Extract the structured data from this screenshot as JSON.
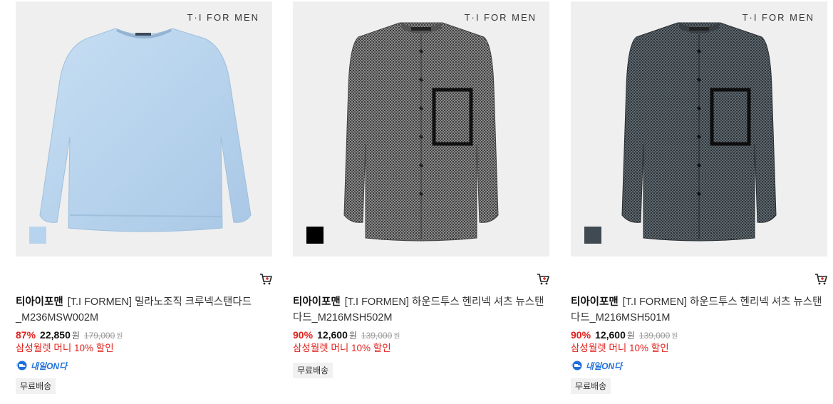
{
  "products": [
    {
      "brand_logo": "T·I FOR MEN",
      "seller": "티아이포맨",
      "name": "[T.I FORMEN] 밀라노조직 크루넥스탠다드_M236MSW002M",
      "discount_rate": "87%",
      "price": "22,850",
      "price_unit": "원",
      "original_price": "179,000",
      "original_unit": "원",
      "benefit": "삼성월렛 머니 10% 할인",
      "nextday_label": "내일ON다",
      "free_shipping": "무료배송",
      "swatch_color": "#b7d4ee",
      "garment_color": "#b9d6ef",
      "garment_type": "sweater",
      "icons": {
        "cart": "cart-icon",
        "nextday": "truck-icon"
      }
    },
    {
      "brand_logo": "T·I FOR MEN",
      "seller": "티아이포맨",
      "name": "[T.I FORMEN] 하운드투스 헨리넥 셔츠 뉴스탠다드_M216MSH502M",
      "discount_rate": "90%",
      "price": "12,600",
      "price_unit": "원",
      "original_price": "139,000",
      "original_unit": "원",
      "benefit": "삼성월렛 머니 10% 할인",
      "free_shipping": "무료배송",
      "swatch_color": "#000000",
      "garment_color": "#6e6e6e",
      "garment_type": "shirt",
      "icons": {
        "cart": "cart-icon"
      }
    },
    {
      "brand_logo": "T·I FOR MEN",
      "seller": "티아이포맨",
      "name": "[T.I FORMEN] 하운드투스 헨리넥 셔츠 뉴스탠다드_M216MSH501M",
      "discount_rate": "90%",
      "price": "12,600",
      "price_unit": "원",
      "original_price": "139,000",
      "original_unit": "원",
      "benefit": "삼성월렛 머니 10% 할인",
      "nextday_label": "내일ON다",
      "free_shipping": "무료배송",
      "swatch_color": "#3f4a52",
      "garment_color": "#4a5258",
      "garment_type": "shirt",
      "icons": {
        "cart": "cart-icon",
        "nextday": "truck-icon"
      }
    }
  ],
  "colors": {
    "accent_red": "#e0221e",
    "nextday_blue": "#1e6fd9",
    "thumb_bg": "#efefef"
  }
}
